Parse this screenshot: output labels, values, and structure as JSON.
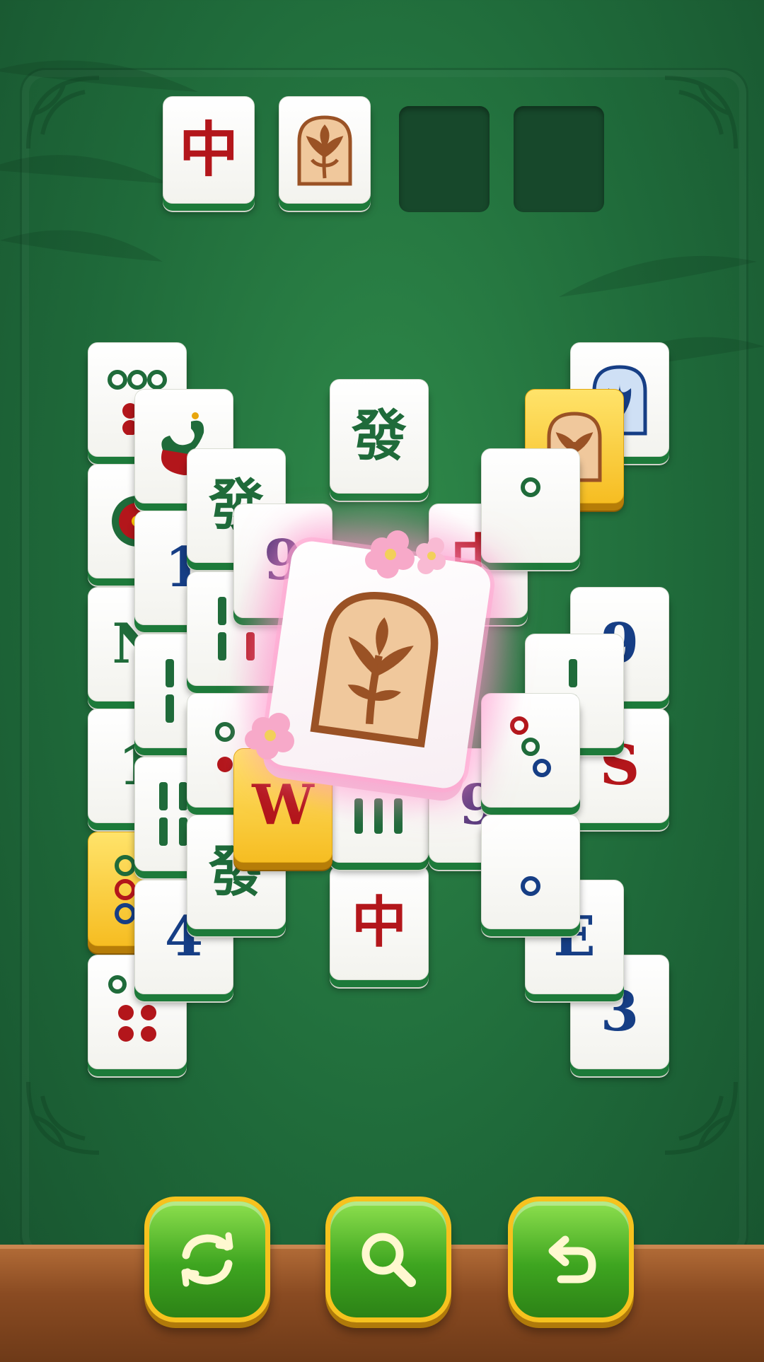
{
  "tray": {
    "slots": [
      {
        "tile": "中",
        "color": "red"
      },
      {
        "tile": "flower",
        "color": "brown"
      },
      {
        "tile": "",
        "color": ""
      },
      {
        "tile": "",
        "color": ""
      }
    ]
  },
  "tiles": {
    "center_top_fa": "發",
    "center_bottom_zhong": "中",
    "center_nine_left": "9",
    "center_zhong": "中",
    "w_tile": "W",
    "nine_right": "9",
    "left_fa": "發",
    "left_fa_lower": "發",
    "left_four": "4",
    "left_n": "N",
    "left_one": "1",
    "right_e": "E",
    "right_three": "3",
    "right_s": "S",
    "right_nine": "9"
  },
  "spotlight": {
    "tile": "flower"
  },
  "buttons": {
    "shuffle": "shuffle-icon",
    "hint": "search-icon",
    "undo": "undo-icon"
  },
  "colors": {
    "felt": "#1f6a3a",
    "tile_face": "#ffffff",
    "gold_tile": "#f6bd22",
    "button_green": "#3ea520",
    "button_border": "#f6c21e"
  }
}
